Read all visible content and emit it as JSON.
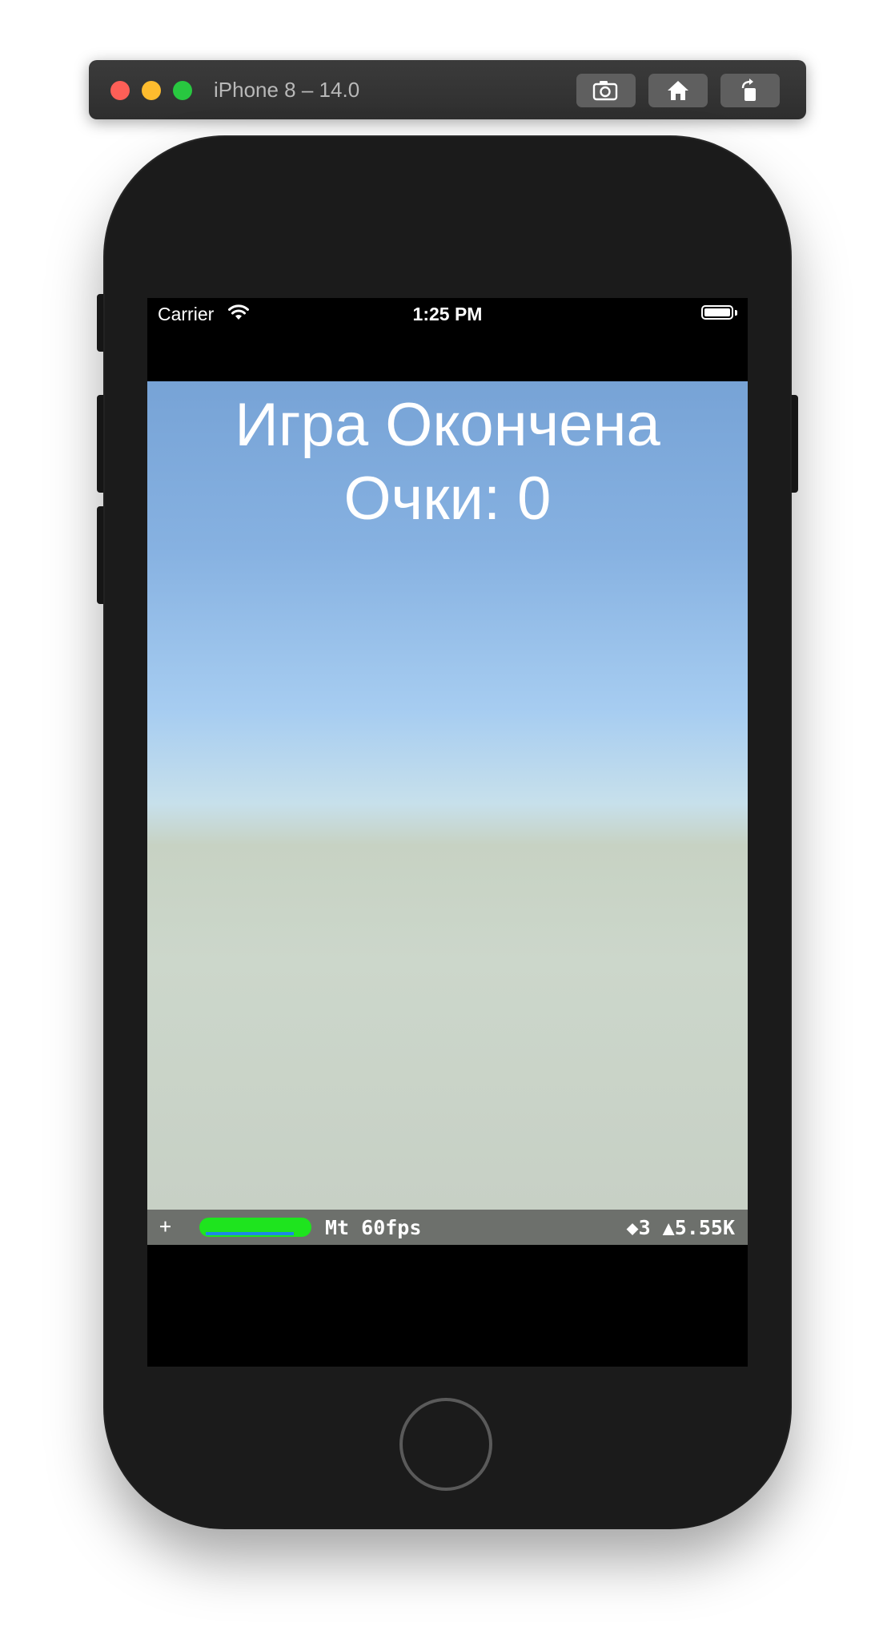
{
  "simulator": {
    "title": "iPhone 8 – 14.0",
    "toolbar": {
      "screenshot_icon": "camera-icon",
      "home_icon": "home-icon",
      "rotate_icon": "rotate-icon"
    },
    "window_controls": {
      "close_color": "#fe5f57",
      "minimize_color": "#febc2e",
      "zoom_color": "#28c840"
    }
  },
  "status_bar": {
    "carrier": "Carrier",
    "time": "1:25 PM",
    "wifi_icon": "wifi-icon",
    "battery_icon": "battery-icon"
  },
  "game": {
    "title": "Игра Окончена",
    "score_text": "Очки: 0"
  },
  "stats": {
    "plus": "+",
    "fps_label": "Mt 60fps",
    "nodes_label": "◆3 ▲5.55K",
    "perf_color": "#1ee41e"
  }
}
